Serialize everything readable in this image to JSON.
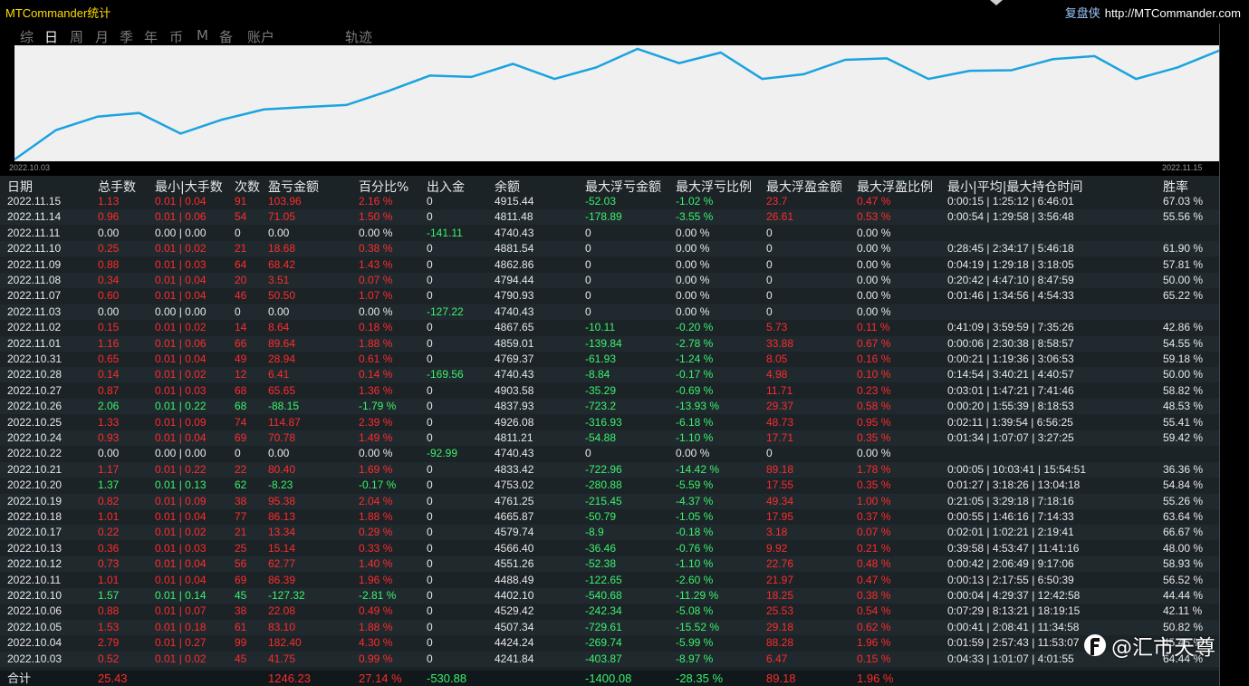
{
  "app_title": "MTCommander统计",
  "brand": {
    "name": "复盘侠",
    "url": "http://MTCommander.com"
  },
  "tabs": [
    {
      "label": "综",
      "active": false
    },
    {
      "label": "日",
      "active": true
    },
    {
      "label": "周",
      "active": false
    },
    {
      "label": "月",
      "active": false
    },
    {
      "label": "季",
      "active": false
    },
    {
      "label": "年",
      "active": false
    },
    {
      "label": "币",
      "active": false
    },
    {
      "label": "M",
      "active": false
    },
    {
      "label": "备",
      "active": false
    },
    {
      "label": "账户",
      "active": false
    },
    {
      "label": "轨迹",
      "active": false
    }
  ],
  "chart_data": {
    "type": "line",
    "x_start_label": "2022.10.03",
    "x_end_label": "2022.11.15",
    "series": [
      {
        "color": "#1aa3e0",
        "x": [
          "2022.10.03",
          "2022.10.04",
          "2022.10.05",
          "2022.10.06",
          "2022.10.10",
          "2022.10.11",
          "2022.10.12",
          "2022.10.13",
          "2022.10.17",
          "2022.10.18",
          "2022.10.19",
          "2022.10.20",
          "2022.10.21",
          "2022.10.22",
          "2022.10.24",
          "2022.10.25",
          "2022.10.26",
          "2022.10.27",
          "2022.10.28",
          "2022.10.31",
          "2022.11.01",
          "2022.11.02",
          "2022.11.03",
          "2022.11.07",
          "2022.11.08",
          "2022.11.09",
          "2022.11.10",
          "2022.11.11",
          "2022.11.14",
          "2022.11.15"
        ],
        "values": [
          4241.84,
          4424.24,
          4507.34,
          4529.42,
          4402.1,
          4488.49,
          4551.26,
          4566.4,
          4579.74,
          4665.87,
          4761.25,
          4753.02,
          4833.42,
          4740.43,
          4811.21,
          4926.08,
          4837.93,
          4903.58,
          4740.43,
          4769.37,
          4859.01,
          4867.65,
          4740.43,
          4790.93,
          4794.44,
          4862.86,
          4881.54,
          4740.43,
          4811.48,
          4915.44
        ]
      }
    ]
  },
  "headers": {
    "date": "日期",
    "total_lots": "总手数",
    "min_max_lots": "最小|大手数",
    "count": "次数",
    "pnl": "盈亏金额",
    "percent": "百分比%",
    "io": "出入金",
    "balance": "余额",
    "max_float_loss": "最大浮亏金额",
    "max_float_loss_pct": "最大浮亏比例",
    "max_float_profit": "最大浮盈金额",
    "max_float_profit_pct": "最大浮盈比例",
    "hold_time": "最小|平均|最大持仓时间",
    "winrate": "胜率"
  },
  "rows": [
    {
      "date": "2022.11.15",
      "lots": "1.13",
      "minmax": "0.01 | 0.04",
      "count": "91",
      "pnl": "103.96",
      "pct": "2.16 %",
      "io": "0",
      "bal": "4915.44",
      "fl": "-52.03",
      "flp": "-1.02 %",
      "fp": "23.7",
      "fpp": "0.47 %",
      "time": "0:00:15 | 1:25:12 | 6:46:01",
      "win": "67.03 %",
      "s": "p"
    },
    {
      "date": "2022.11.14",
      "lots": "0.96",
      "minmax": "0.01 | 0.06",
      "count": "54",
      "pnl": "71.05",
      "pct": "1.50 %",
      "io": "0",
      "bal": "4811.48",
      "fl": "-178.89",
      "flp": "-3.55 %",
      "fp": "26.61",
      "fpp": "0.53 %",
      "time": "0:00:54 | 1:29:58 | 3:56:48",
      "win": "55.56 %",
      "s": "p"
    },
    {
      "date": "2022.11.11",
      "lots": "0.00",
      "minmax": "0.00 | 0.00",
      "count": "0",
      "pnl": "0.00",
      "pct": "0.00 %",
      "io": "-141.11",
      "bal": "4740.43",
      "fl": "0",
      "flp": "0.00 %",
      "fp": "0",
      "fpp": "0.00 %",
      "time": "",
      "win": "",
      "s": "z"
    },
    {
      "date": "2022.11.10",
      "lots": "0.25",
      "minmax": "0.01 | 0.02",
      "count": "21",
      "pnl": "18.68",
      "pct": "0.38 %",
      "io": "0",
      "bal": "4881.54",
      "fl": "0",
      "flp": "0.00 %",
      "fp": "0",
      "fpp": "0.00 %",
      "time": "0:28:45 | 2:34:17 | 5:46:18",
      "win": "61.90 %",
      "s": "p"
    },
    {
      "date": "2022.11.09",
      "lots": "0.88",
      "minmax": "0.01 | 0.03",
      "count": "64",
      "pnl": "68.42",
      "pct": "1.43 %",
      "io": "0",
      "bal": "4862.86",
      "fl": "0",
      "flp": "0.00 %",
      "fp": "0",
      "fpp": "0.00 %",
      "time": "0:04:19 | 1:29:18 | 3:18:05",
      "win": "57.81 %",
      "s": "p"
    },
    {
      "date": "2022.11.08",
      "lots": "0.34",
      "minmax": "0.01 | 0.04",
      "count": "20",
      "pnl": "3.51",
      "pct": "0.07 %",
      "io": "0",
      "bal": "4794.44",
      "fl": "0",
      "flp": "0.00 %",
      "fp": "0",
      "fpp": "0.00 %",
      "time": "0:20:42 | 4:47:10 | 8:47:59",
      "win": "50.00 %",
      "s": "p"
    },
    {
      "date": "2022.11.07",
      "lots": "0.60",
      "minmax": "0.01 | 0.04",
      "count": "46",
      "pnl": "50.50",
      "pct": "1.07 %",
      "io": "0",
      "bal": "4790.93",
      "fl": "0",
      "flp": "0.00 %",
      "fp": "0",
      "fpp": "0.00 %",
      "time": "0:01:46 | 1:34:56 | 4:54:33",
      "win": "65.22 %",
      "s": "p"
    },
    {
      "date": "2022.11.03",
      "lots": "0.00",
      "minmax": "0.00 | 0.00",
      "count": "0",
      "pnl": "0.00",
      "pct": "0.00 %",
      "io": "-127.22",
      "bal": "4740.43",
      "fl": "0",
      "flp": "0.00 %",
      "fp": "0",
      "fpp": "0.00 %",
      "time": "",
      "win": "",
      "s": "z"
    },
    {
      "date": "2022.11.02",
      "lots": "0.15",
      "minmax": "0.01 | 0.02",
      "count": "14",
      "pnl": "8.64",
      "pct": "0.18 %",
      "io": "0",
      "bal": "4867.65",
      "fl": "-10.11",
      "flp": "-0.20 %",
      "fp": "5.73",
      "fpp": "0.11 %",
      "time": "0:41:09 | 3:59:59 | 7:35:26",
      "win": "42.86 %",
      "s": "p"
    },
    {
      "date": "2022.11.01",
      "lots": "1.16",
      "minmax": "0.01 | 0.06",
      "count": "66",
      "pnl": "89.64",
      "pct": "1.88 %",
      "io": "0",
      "bal": "4859.01",
      "fl": "-139.84",
      "flp": "-2.78 %",
      "fp": "33.88",
      "fpp": "0.67 %",
      "time": "0:00:06 | 2:30:38 | 8:58:57",
      "win": "54.55 %",
      "s": "p"
    },
    {
      "date": "2022.10.31",
      "lots": "0.65",
      "minmax": "0.01 | 0.04",
      "count": "49",
      "pnl": "28.94",
      "pct": "0.61 %",
      "io": "0",
      "bal": "4769.37",
      "fl": "-61.93",
      "flp": "-1.24 %",
      "fp": "8.05",
      "fpp": "0.16 %",
      "time": "0:00:21 | 1:19:36 | 3:06:53",
      "win": "59.18 %",
      "s": "p"
    },
    {
      "date": "2022.10.28",
      "lots": "0.14",
      "minmax": "0.01 | 0.02",
      "count": "12",
      "pnl": "6.41",
      "pct": "0.14 %",
      "io": "-169.56",
      "bal": "4740.43",
      "fl": "-8.84",
      "flp": "-0.17 %",
      "fp": "4.98",
      "fpp": "0.10 %",
      "time": "0:14:54 | 3:40:21 | 4:40:57",
      "win": "50.00 %",
      "s": "p"
    },
    {
      "date": "2022.10.27",
      "lots": "0.87",
      "minmax": "0.01 | 0.03",
      "count": "68",
      "pnl": "65.65",
      "pct": "1.36 %",
      "io": "0",
      "bal": "4903.58",
      "fl": "-35.29",
      "flp": "-0.69 %",
      "fp": "11.71",
      "fpp": "0.23 %",
      "time": "0:03:01 | 1:47:21 | 7:41:46",
      "win": "58.82 %",
      "s": "p"
    },
    {
      "date": "2022.10.26",
      "lots": "2.06",
      "minmax": "0.01 | 0.22",
      "count": "68",
      "pnl": "-88.15",
      "pct": "-1.79 %",
      "io": "0",
      "bal": "4837.93",
      "fl": "-723.2",
      "flp": "-13.93 %",
      "fp": "29.37",
      "fpp": "0.58 %",
      "time": "0:00:20 | 1:55:39 | 8:18:53",
      "win": "48.53 %",
      "s": "n"
    },
    {
      "date": "2022.10.25",
      "lots": "1.33",
      "minmax": "0.01 | 0.09",
      "count": "74",
      "pnl": "114.87",
      "pct": "2.39 %",
      "io": "0",
      "bal": "4926.08",
      "fl": "-316.93",
      "flp": "-6.18 %",
      "fp": "48.73",
      "fpp": "0.95 %",
      "time": "0:02:11 | 1:39:54 | 6:56:25",
      "win": "55.41 %",
      "s": "p"
    },
    {
      "date": "2022.10.24",
      "lots": "0.93",
      "minmax": "0.01 | 0.04",
      "count": "69",
      "pnl": "70.78",
      "pct": "1.49 %",
      "io": "0",
      "bal": "4811.21",
      "fl": "-54.88",
      "flp": "-1.10 %",
      "fp": "17.71",
      "fpp": "0.35 %",
      "time": "0:01:34 | 1:07:07 | 3:27:25",
      "win": "59.42 %",
      "s": "p"
    },
    {
      "date": "2022.10.22",
      "lots": "0.00",
      "minmax": "0.00 | 0.00",
      "count": "0",
      "pnl": "0.00",
      "pct": "0.00 %",
      "io": "-92.99",
      "bal": "4740.43",
      "fl": "0",
      "flp": "0.00 %",
      "fp": "0",
      "fpp": "0.00 %",
      "time": "",
      "win": "",
      "s": "z"
    },
    {
      "date": "2022.10.21",
      "lots": "1.17",
      "minmax": "0.01 | 0.22",
      "count": "22",
      "pnl": "80.40",
      "pct": "1.69 %",
      "io": "0",
      "bal": "4833.42",
      "fl": "-722.96",
      "flp": "-14.42 %",
      "fp": "89.18",
      "fpp": "1.78 %",
      "time": "0:00:05 | 10:03:41 | 15:54:51",
      "win": "36.36 %",
      "s": "p"
    },
    {
      "date": "2022.10.20",
      "lots": "1.37",
      "minmax": "0.01 | 0.13",
      "count": "62",
      "pnl": "-8.23",
      "pct": "-0.17 %",
      "io": "0",
      "bal": "4753.02",
      "fl": "-280.88",
      "flp": "-5.59 %",
      "fp": "17.55",
      "fpp": "0.35 %",
      "time": "0:01:27 | 3:18:26 | 13:04:18",
      "win": "54.84 %",
      "s": "n"
    },
    {
      "date": "2022.10.19",
      "lots": "0.82",
      "minmax": "0.01 | 0.09",
      "count": "38",
      "pnl": "95.38",
      "pct": "2.04 %",
      "io": "0",
      "bal": "4761.25",
      "fl": "-215.45",
      "flp": "-4.37 %",
      "fp": "49.34",
      "fpp": "1.00 %",
      "time": "0:21:05 | 3:29:18 | 7:18:16",
      "win": "55.26 %",
      "s": "p"
    },
    {
      "date": "2022.10.18",
      "lots": "1.01",
      "minmax": "0.01 | 0.04",
      "count": "77",
      "pnl": "86.13",
      "pct": "1.88 %",
      "io": "0",
      "bal": "4665.87",
      "fl": "-50.79",
      "flp": "-1.05 %",
      "fp": "17.95",
      "fpp": "0.37 %",
      "time": "0:00:55 | 1:46:16 | 7:14:33",
      "win": "63.64 %",
      "s": "p"
    },
    {
      "date": "2022.10.17",
      "lots": "0.22",
      "minmax": "0.01 | 0.02",
      "count": "21",
      "pnl": "13.34",
      "pct": "0.29 %",
      "io": "0",
      "bal": "4579.74",
      "fl": "-8.9",
      "flp": "-0.18 %",
      "fp": "3.18",
      "fpp": "0.07 %",
      "time": "0:02:01 | 1:02:21 | 2:19:41",
      "win": "66.67 %",
      "s": "p"
    },
    {
      "date": "2022.10.13",
      "lots": "0.36",
      "minmax": "0.01 | 0.03",
      "count": "25",
      "pnl": "15.14",
      "pct": "0.33 %",
      "io": "0",
      "bal": "4566.40",
      "fl": "-36.46",
      "flp": "-0.76 %",
      "fp": "9.92",
      "fpp": "0.21 %",
      "time": "0:39:58 | 4:53:47 | 11:41:16",
      "win": "48.00 %",
      "s": "p"
    },
    {
      "date": "2022.10.12",
      "lots": "0.73",
      "minmax": "0.01 | 0.04",
      "count": "56",
      "pnl": "62.77",
      "pct": "1.40 %",
      "io": "0",
      "bal": "4551.26",
      "fl": "-52.38",
      "flp": "-1.10 %",
      "fp": "22.76",
      "fpp": "0.48 %",
      "time": "0:00:42 | 2:06:49 | 9:17:06",
      "win": "58.93 %",
      "s": "p"
    },
    {
      "date": "2022.10.11",
      "lots": "1.01",
      "minmax": "0.01 | 0.04",
      "count": "69",
      "pnl": "86.39",
      "pct": "1.96 %",
      "io": "0",
      "bal": "4488.49",
      "fl": "-122.65",
      "flp": "-2.60 %",
      "fp": "21.97",
      "fpp": "0.47 %",
      "time": "0:00:13 | 2:17:55 | 6:50:39",
      "win": "56.52 %",
      "s": "p"
    },
    {
      "date": "2022.10.10",
      "lots": "1.57",
      "minmax": "0.01 | 0.14",
      "count": "45",
      "pnl": "-127.32",
      "pct": "-2.81 %",
      "io": "0",
      "bal": "4402.10",
      "fl": "-540.68",
      "flp": "-11.29 %",
      "fp": "18.25",
      "fpp": "0.38 %",
      "time": "0:00:04 | 4:29:37 | 12:42:58",
      "win": "44.44 %",
      "s": "n"
    },
    {
      "date": "2022.10.06",
      "lots": "0.88",
      "minmax": "0.01 | 0.07",
      "count": "38",
      "pnl": "22.08",
      "pct": "0.49 %",
      "io": "0",
      "bal": "4529.42",
      "fl": "-242.34",
      "flp": "-5.08 %",
      "fp": "25.53",
      "fpp": "0.54 %",
      "time": "0:07:29 | 8:13:21 | 18:19:15",
      "win": "42.11 %",
      "s": "p"
    },
    {
      "date": "2022.10.05",
      "lots": "1.53",
      "minmax": "0.01 | 0.18",
      "count": "61",
      "pnl": "83.10",
      "pct": "1.88 %",
      "io": "0",
      "bal": "4507.34",
      "fl": "-729.61",
      "flp": "-15.52 %",
      "fp": "29.18",
      "fpp": "0.62 %",
      "time": "0:00:41 | 2:08:41 | 11:34:58",
      "win": "50.82 %",
      "s": "p"
    },
    {
      "date": "2022.10.04",
      "lots": "2.79",
      "minmax": "0.01 | 0.27",
      "count": "99",
      "pnl": "182.40",
      "pct": "4.30 %",
      "io": "0",
      "bal": "4424.24",
      "fl": "-269.74",
      "flp": "-5.99 %",
      "fp": "88.28",
      "fpp": "1.96 %",
      "time": "0:01:59 | 2:57:43 | 11:53:07",
      "win": "45.45 %",
      "s": "p"
    },
    {
      "date": "2022.10.03",
      "lots": "0.52",
      "minmax": "0.01 | 0.02",
      "count": "45",
      "pnl": "41.75",
      "pct": "0.99 %",
      "io": "0",
      "bal": "4241.84",
      "fl": "-403.87",
      "flp": "-8.97 %",
      "fp": "6.47",
      "fpp": "0.15 %",
      "time": "0:04:33 | 1:01:07 | 4:01:55",
      "win": "64.44 %",
      "s": "p"
    }
  ],
  "total": {
    "label": "合计",
    "lots": "25.43",
    "pnl": "1246.23",
    "pct": "27.14 %",
    "io": "-530.88",
    "fl": "-1400.08",
    "flp": "-28.35 %",
    "fp": "89.18",
    "fpp": "1.96 %"
  },
  "watermark": "@汇市天尊"
}
